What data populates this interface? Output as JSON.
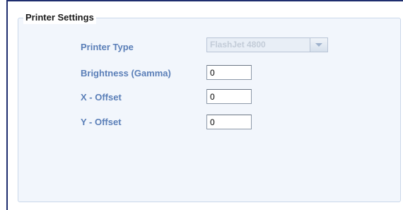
{
  "panel": {
    "legend": "Printer Settings"
  },
  "fields": {
    "printer_type": {
      "label": "Printer Type",
      "value": "FlashJet 4800",
      "icon": "chevron-down-icon"
    },
    "brightness": {
      "label": "Brightness (Gamma)",
      "value": "0"
    },
    "x_offset": {
      "label": "X - Offset",
      "value": "0"
    },
    "y_offset": {
      "label": "Y - Offset",
      "value": "0"
    }
  },
  "colors": {
    "label": "#5b7fb8",
    "frame_border": "#1e2d6e",
    "panel_bg": "#f2f6fc"
  }
}
